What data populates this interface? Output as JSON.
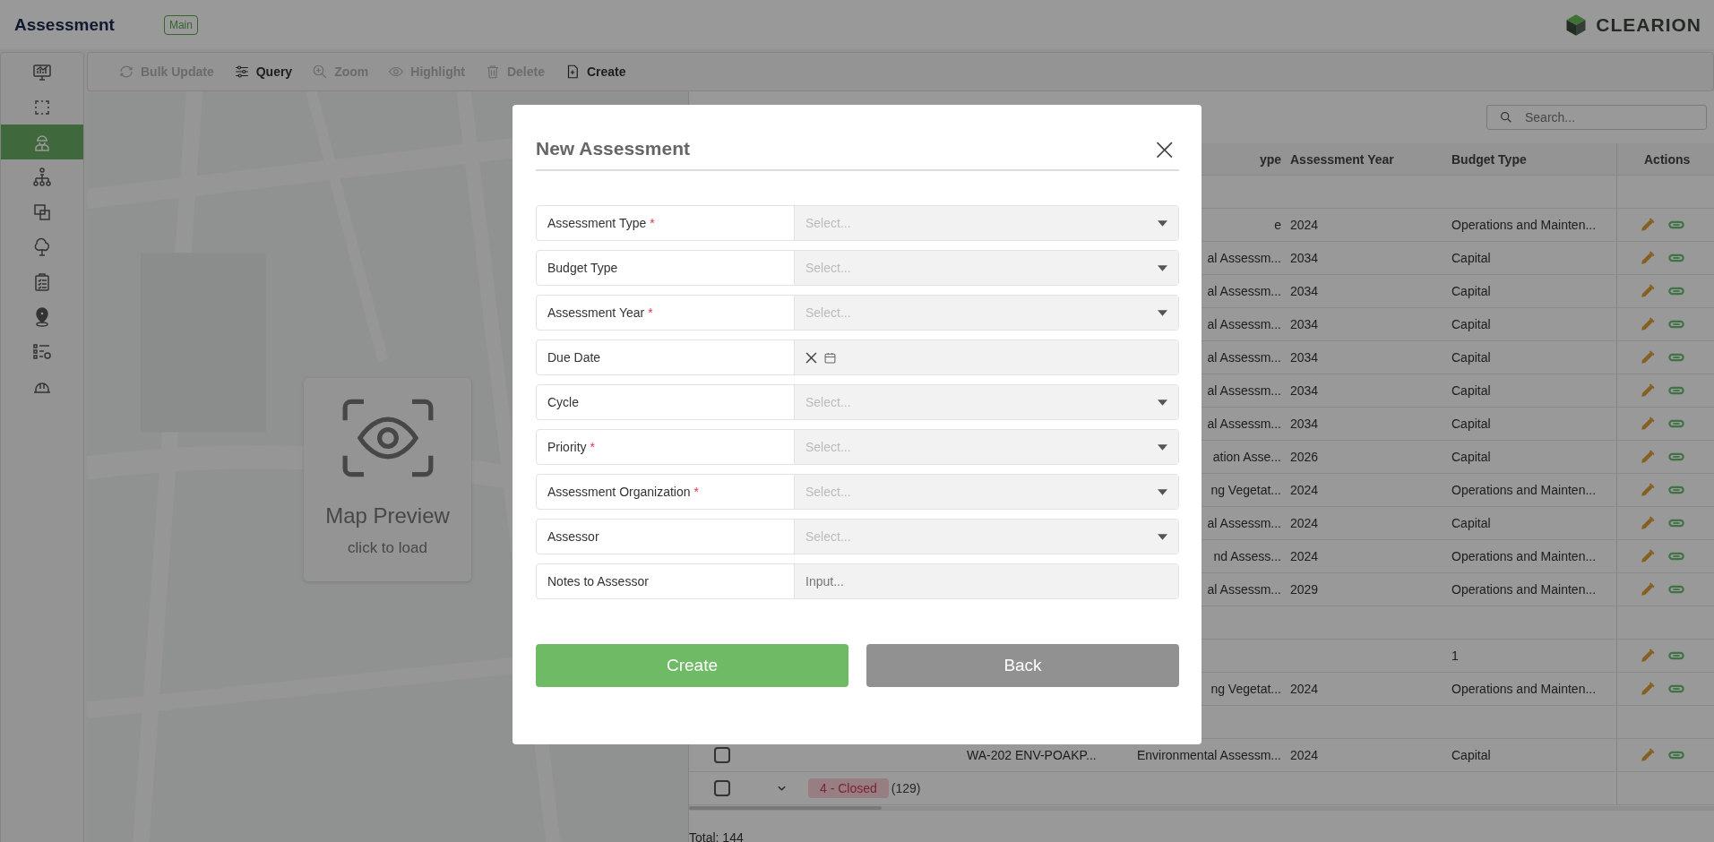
{
  "header": {
    "title": "Assessment",
    "tag": "Main",
    "logo": "CLEARION"
  },
  "sidebar": {
    "items": [
      {
        "selected": false
      },
      {
        "selected": false
      },
      {
        "selected": true
      },
      {
        "selected": false
      },
      {
        "selected": false
      },
      {
        "selected": false
      },
      {
        "selected": false
      },
      {
        "selected": false
      },
      {
        "selected": false
      },
      {
        "selected": false
      }
    ]
  },
  "toolbar": [
    {
      "label": "Bulk Update",
      "disabled": true
    },
    {
      "label": "Query",
      "disabled": false
    },
    {
      "label": "Zoom",
      "disabled": true
    },
    {
      "label": "Highlight",
      "disabled": true
    },
    {
      "label": "Delete",
      "disabled": true
    },
    {
      "label": "Create",
      "disabled": false
    }
  ],
  "map_preview": {
    "title": "Map Preview",
    "hint": "click to load"
  },
  "table": {
    "search": {
      "placeholder": "Search..."
    },
    "columns": [
      "ype",
      "Assessment Year",
      "Budget Type",
      "Actions"
    ],
    "rows": [
      {
        "kind": "group"
      },
      {
        "kind": "data",
        "type": "e",
        "year": "2024",
        "budget": "Operations and Mainten..."
      },
      {
        "kind": "data",
        "type": "al Assessm...",
        "year": "2034",
        "budget": "Capital"
      },
      {
        "kind": "data",
        "type": "al Assessm...",
        "year": "2034",
        "budget": "Capital"
      },
      {
        "kind": "data",
        "type": "al Assessm...",
        "year": "2034",
        "budget": "Capital"
      },
      {
        "kind": "data",
        "type": "al Assessm...",
        "year": "2034",
        "budget": "Capital"
      },
      {
        "kind": "data",
        "type": "al Assessm...",
        "year": "2034",
        "budget": "Capital"
      },
      {
        "kind": "data",
        "type": "al Assessm...",
        "year": "2034",
        "budget": "Capital"
      },
      {
        "kind": "data",
        "type": "ation Asse...",
        "year": "2026",
        "budget": "Capital"
      },
      {
        "kind": "data",
        "type": "ng Vegetat...",
        "year": "2024",
        "budget": "Operations and Mainten..."
      },
      {
        "kind": "data",
        "type": "al Assessm...",
        "year": "2024",
        "budget": "Capital"
      },
      {
        "kind": "data",
        "type": "nd Assess...",
        "year": "2024",
        "budget": "Operations and Mainten..."
      },
      {
        "kind": "data",
        "type": "al Assessm...",
        "year": "2029",
        "budget": "Operations and Mainten..."
      },
      {
        "kind": "group"
      },
      {
        "kind": "data",
        "budget": "1"
      },
      {
        "kind": "data",
        "type": "ng Vegetat...",
        "year": "2024",
        "budget": "Operations and Mainten..."
      },
      {
        "kind": "group"
      },
      {
        "kind": "data",
        "checked": false,
        "id": "WA-202 ENV-POAKP...",
        "type": "Environmental Assessm...",
        "year": "2024",
        "budget": "Capital"
      },
      {
        "kind": "group",
        "checked": false,
        "expanded": false,
        "tag": "4 - Closed",
        "count": "(129)"
      }
    ],
    "total": "Total: 144"
  },
  "dialog": {
    "title": "New Assessment",
    "close": "×",
    "required_mark": "*",
    "fields": [
      {
        "label": "Assessment Type",
        "required": true,
        "kind": "select",
        "placeholder": "Select..."
      },
      {
        "label": "Budget Type",
        "required": false,
        "kind": "select",
        "placeholder": "Select..."
      },
      {
        "label": "Assessment Year",
        "required": true,
        "kind": "select",
        "placeholder": "Select..."
      },
      {
        "label": "Due Date",
        "required": false,
        "kind": "date"
      },
      {
        "label": "Cycle",
        "required": false,
        "kind": "select",
        "placeholder": "Select..."
      },
      {
        "label": "Priority",
        "required": true,
        "kind": "select",
        "placeholder": "Select..."
      },
      {
        "label": "Assessment Organization",
        "required": true,
        "kind": "select",
        "placeholder": "Select..."
      },
      {
        "label": "Assessor",
        "required": false,
        "kind": "select",
        "placeholder": "Select..."
      },
      {
        "label": "Notes to Assessor",
        "required": false,
        "kind": "input",
        "placeholder": "Input..."
      }
    ],
    "buttons": [
      {
        "label": "Create",
        "kind": "primary"
      },
      {
        "label": "Back",
        "kind": "secondary"
      }
    ]
  }
}
